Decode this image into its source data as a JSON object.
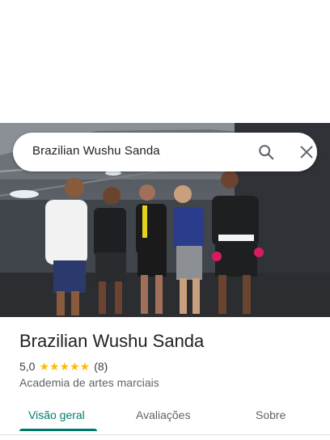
{
  "search": {
    "query": "Brazilian Wushu Sanda"
  },
  "place": {
    "title": "Brazilian Wushu Sanda",
    "rating": "5,0",
    "stars": "★★★★★",
    "review_count": "(8)",
    "category": "Academia de artes marciais"
  },
  "tabs": [
    {
      "label": "Visão geral",
      "active": true
    },
    {
      "label": "Avaliações",
      "active": false
    },
    {
      "label": "Sobre",
      "active": false
    }
  ],
  "colors": {
    "accent": "#00796b",
    "star": "#fbbc04"
  }
}
